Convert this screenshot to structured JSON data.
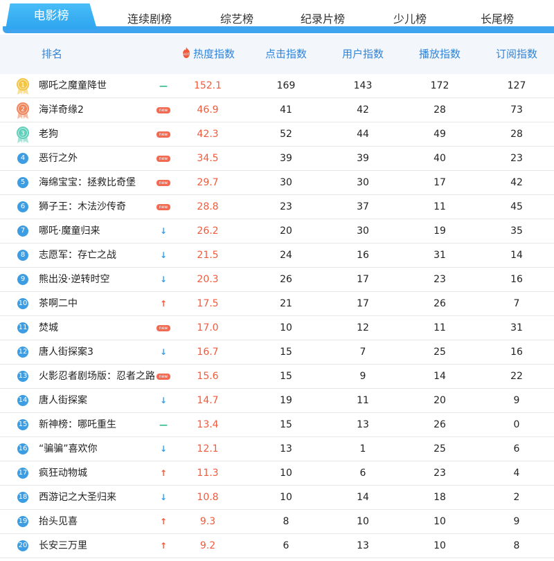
{
  "tabs": [
    {
      "label": "电影榜",
      "active": true
    },
    {
      "label": "连续剧榜",
      "active": false
    },
    {
      "label": "综艺榜",
      "active": false
    },
    {
      "label": "纪录片榜",
      "active": false
    },
    {
      "label": "少儿榜",
      "active": false
    },
    {
      "label": "长尾榜",
      "active": false
    }
  ],
  "headers": {
    "rank": "排名",
    "hot_icon_text": "HOT",
    "hot": "热度指数",
    "click": "点击指数",
    "user": "用户指数",
    "play": "播放指数",
    "sub": "订阅指数"
  },
  "trend_glyphs": {
    "up": "↑",
    "down": "↓",
    "flat": "—"
  },
  "new_badge": "new",
  "colors": {
    "accent": "#3fa4ef",
    "hot": "#f05a3c",
    "new_badge": "#f26a52",
    "flat": "#24b48a",
    "header_text": "#2f83d8",
    "gold": "#f4c542",
    "orange": "#f0845a",
    "teal": "#5fd0b9"
  },
  "rows": [
    {
      "rank": "1",
      "name": "哪吒之魔童降世",
      "trend": "flat",
      "hot": "152.1",
      "click": "169",
      "user": "143",
      "play": "172",
      "sub": "127"
    },
    {
      "rank": "2",
      "name": "海洋奇缘2",
      "trend": "new",
      "hot": "46.9",
      "click": "41",
      "user": "42",
      "play": "28",
      "sub": "73"
    },
    {
      "rank": "3",
      "name": "老狗",
      "trend": "new",
      "hot": "42.3",
      "click": "52",
      "user": "44",
      "play": "49",
      "sub": "28"
    },
    {
      "rank": "4",
      "name": "恶行之外",
      "trend": "new",
      "hot": "34.5",
      "click": "39",
      "user": "39",
      "play": "40",
      "sub": "23"
    },
    {
      "rank": "5",
      "name": "海绵宝宝：拯救比奇堡",
      "trend": "new",
      "hot": "29.7",
      "click": "30",
      "user": "30",
      "play": "17",
      "sub": "42"
    },
    {
      "rank": "6",
      "name": "狮子王：木法沙传奇",
      "trend": "new",
      "hot": "28.8",
      "click": "23",
      "user": "37",
      "play": "11",
      "sub": "45"
    },
    {
      "rank": "7",
      "name": "哪吒·魔童归来",
      "trend": "down",
      "hot": "26.2",
      "click": "20",
      "user": "30",
      "play": "19",
      "sub": "35"
    },
    {
      "rank": "8",
      "name": "志愿军：存亡之战",
      "trend": "down",
      "hot": "21.5",
      "click": "24",
      "user": "16",
      "play": "31",
      "sub": "14"
    },
    {
      "rank": "9",
      "name": "熊出没·逆转时空",
      "trend": "down",
      "hot": "20.3",
      "click": "26",
      "user": "17",
      "play": "23",
      "sub": "16"
    },
    {
      "rank": "10",
      "name": "茶啊二中",
      "trend": "up",
      "hot": "17.5",
      "click": "21",
      "user": "17",
      "play": "26",
      "sub": "7"
    },
    {
      "rank": "11",
      "name": "焚城",
      "trend": "new",
      "hot": "17.0",
      "click": "10",
      "user": "12",
      "play": "11",
      "sub": "31"
    },
    {
      "rank": "12",
      "name": "唐人街探案3",
      "trend": "down",
      "hot": "16.7",
      "click": "15",
      "user": "7",
      "play": "25",
      "sub": "16"
    },
    {
      "rank": "13",
      "name": "火影忍者剧场版：忍者之路",
      "trend": "new",
      "hot": "15.6",
      "click": "15",
      "user": "9",
      "play": "14",
      "sub": "22"
    },
    {
      "rank": "14",
      "name": "唐人街探案",
      "trend": "down",
      "hot": "14.7",
      "click": "19",
      "user": "11",
      "play": "20",
      "sub": "9"
    },
    {
      "rank": "15",
      "name": "新神榜：哪吒重生",
      "trend": "flat",
      "hot": "13.4",
      "click": "15",
      "user": "13",
      "play": "26",
      "sub": "0"
    },
    {
      "rank": "16",
      "name": "“骗骗”喜欢你",
      "trend": "down",
      "hot": "12.1",
      "click": "13",
      "user": "1",
      "play": "25",
      "sub": "6"
    },
    {
      "rank": "17",
      "name": "疯狂动物城",
      "trend": "up",
      "hot": "11.3",
      "click": "10",
      "user": "6",
      "play": "23",
      "sub": "4"
    },
    {
      "rank": "18",
      "name": "西游记之大圣归来",
      "trend": "down",
      "hot": "10.8",
      "click": "10",
      "user": "14",
      "play": "18",
      "sub": "2"
    },
    {
      "rank": "19",
      "name": "抬头见喜",
      "trend": "up",
      "hot": "9.3",
      "click": "8",
      "user": "10",
      "play": "10",
      "sub": "9"
    },
    {
      "rank": "20",
      "name": "长安三万里",
      "trend": "up",
      "hot": "9.2",
      "click": "6",
      "user": "13",
      "play": "10",
      "sub": "8"
    }
  ]
}
